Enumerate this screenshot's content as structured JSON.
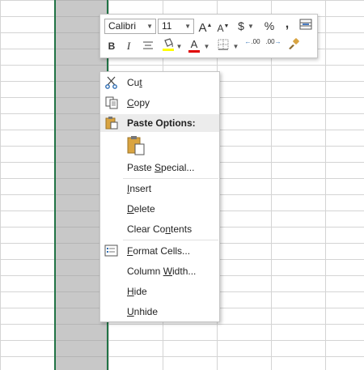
{
  "mini_toolbar": {
    "font_name": "Calibri",
    "font_size": "11",
    "grow_font": "A",
    "shrink_font": "A",
    "currency": "$",
    "percent": "%",
    "comma": ",",
    "bold": "B",
    "italic": "I",
    "font_color_letter": "A",
    "inc_decimal": ".00",
    "dec_decimal": ".00",
    "highlight_color": "#ffff00",
    "font_color": "#e00000"
  },
  "context_menu": {
    "items": [
      {
        "pre": "Cu",
        "u": "t",
        "post": ""
      },
      {
        "pre": "",
        "u": "C",
        "post": "opy"
      },
      {
        "label": "Paste Options:"
      },
      {
        "pre": "Paste ",
        "u": "S",
        "post": "pecial..."
      },
      {
        "pre": "",
        "u": "I",
        "post": "nsert"
      },
      {
        "pre": "",
        "u": "D",
        "post": "elete"
      },
      {
        "pre": "Clear Co",
        "u": "n",
        "post": "tents"
      },
      {
        "pre": "",
        "u": "F",
        "post": "ormat Cells..."
      },
      {
        "pre": "Column ",
        "u": "W",
        "post": "idth..."
      },
      {
        "pre": "",
        "u": "H",
        "post": "ide"
      },
      {
        "pre": "",
        "u": "U",
        "post": "nhide"
      }
    ]
  },
  "colors": {
    "selection_border": "#217346",
    "selected_column_fill": "#c8c8c8"
  }
}
